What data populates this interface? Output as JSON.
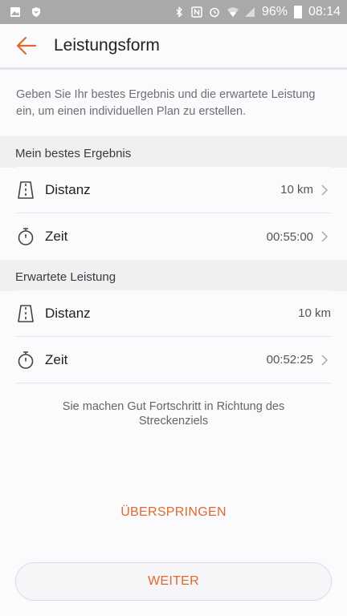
{
  "status_bar": {
    "battery": "96%",
    "time": "08:14",
    "icons": [
      "image-icon",
      "shield-icon",
      "bluetooth-icon",
      "nfc-icon",
      "alarm-icon",
      "wifi-icon",
      "signal-icon",
      "battery-icon"
    ]
  },
  "header": {
    "title": "Leistungsform",
    "back_icon": "arrow-left-icon"
  },
  "intro": "Geben Sie Ihr bestes Ergebnis und die erwartete Leistung ein, um einen individuellen Plan zu erstellen.",
  "best_result": {
    "heading": "Mein bestes Ergebnis",
    "rows": [
      {
        "icon": "road-icon",
        "label": "Distanz",
        "value": "10 km"
      },
      {
        "icon": "stopwatch-icon",
        "label": "Zeit",
        "value": "00:55:00"
      }
    ]
  },
  "expected": {
    "heading": "Erwartete Leistung",
    "rows": [
      {
        "icon": "road-icon",
        "label": "Distanz",
        "value": "10 km"
      },
      {
        "icon": "stopwatch-icon",
        "label": "Zeit",
        "value": "00:52:25"
      }
    ]
  },
  "note": "Sie machen Gut Fortschritt in Richtung des Streckenziels",
  "buttons": {
    "skip": "ÜBERSPRINGEN",
    "continue": "WEITER"
  },
  "colors": {
    "accent": "#e06a2b",
    "status_bar": "#a9a9ac",
    "section_bg": "#f0eff2",
    "background": "#fbfafc"
  }
}
